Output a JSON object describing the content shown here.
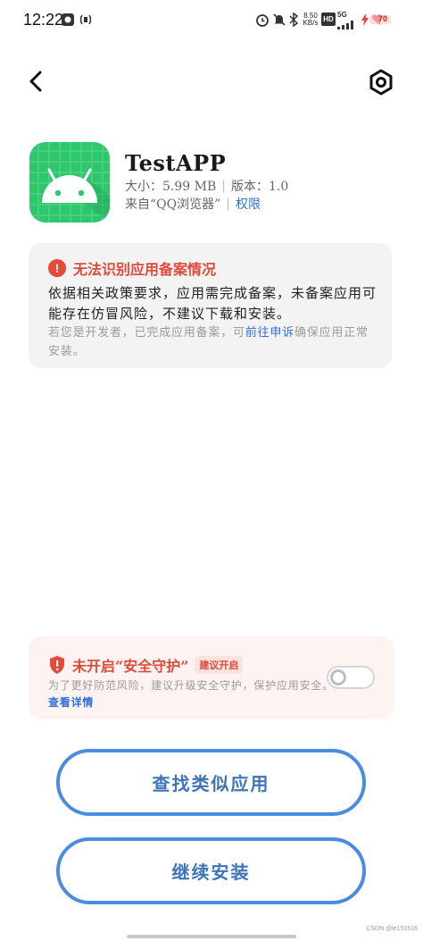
{
  "status_bar": {
    "time": "12:22",
    "net_speed_top": "8.50",
    "net_speed_unit": "KB/s",
    "hd_label": "HD",
    "signal_label": "5G",
    "battery": "70"
  },
  "app": {
    "name": "TestAPP",
    "size_label": "大小：5.99 MB",
    "version_label": "版本：1.0",
    "source_label": "来自“QQ浏览器”",
    "permissions_label": "权限",
    "separator": "|",
    "icon_color": "#2ec76b"
  },
  "warning": {
    "title": "无法识别应用备案情况",
    "body": "依据相关政策要求，应用需完成备案，未备案应用可能存在仿冒风险，不建议下载和安装。",
    "note_prefix": "若您是开发者，已完成应用备案，可",
    "note_link": "前往申诉",
    "note_suffix": "确保应用正常安装。",
    "accent_color": "#e04a3a"
  },
  "protection": {
    "title": "未开启“安全守护”",
    "badge": "建议开启",
    "body": "为了更好防范风险，建议升级安全守护，保护应用安全。",
    "link": "查看详情",
    "toggle_on": false
  },
  "buttons": {
    "find_similar": "查找类似应用",
    "continue_install": "继续安装",
    "color": "#4a8ce0"
  },
  "watermark": "CSDN @le151616"
}
